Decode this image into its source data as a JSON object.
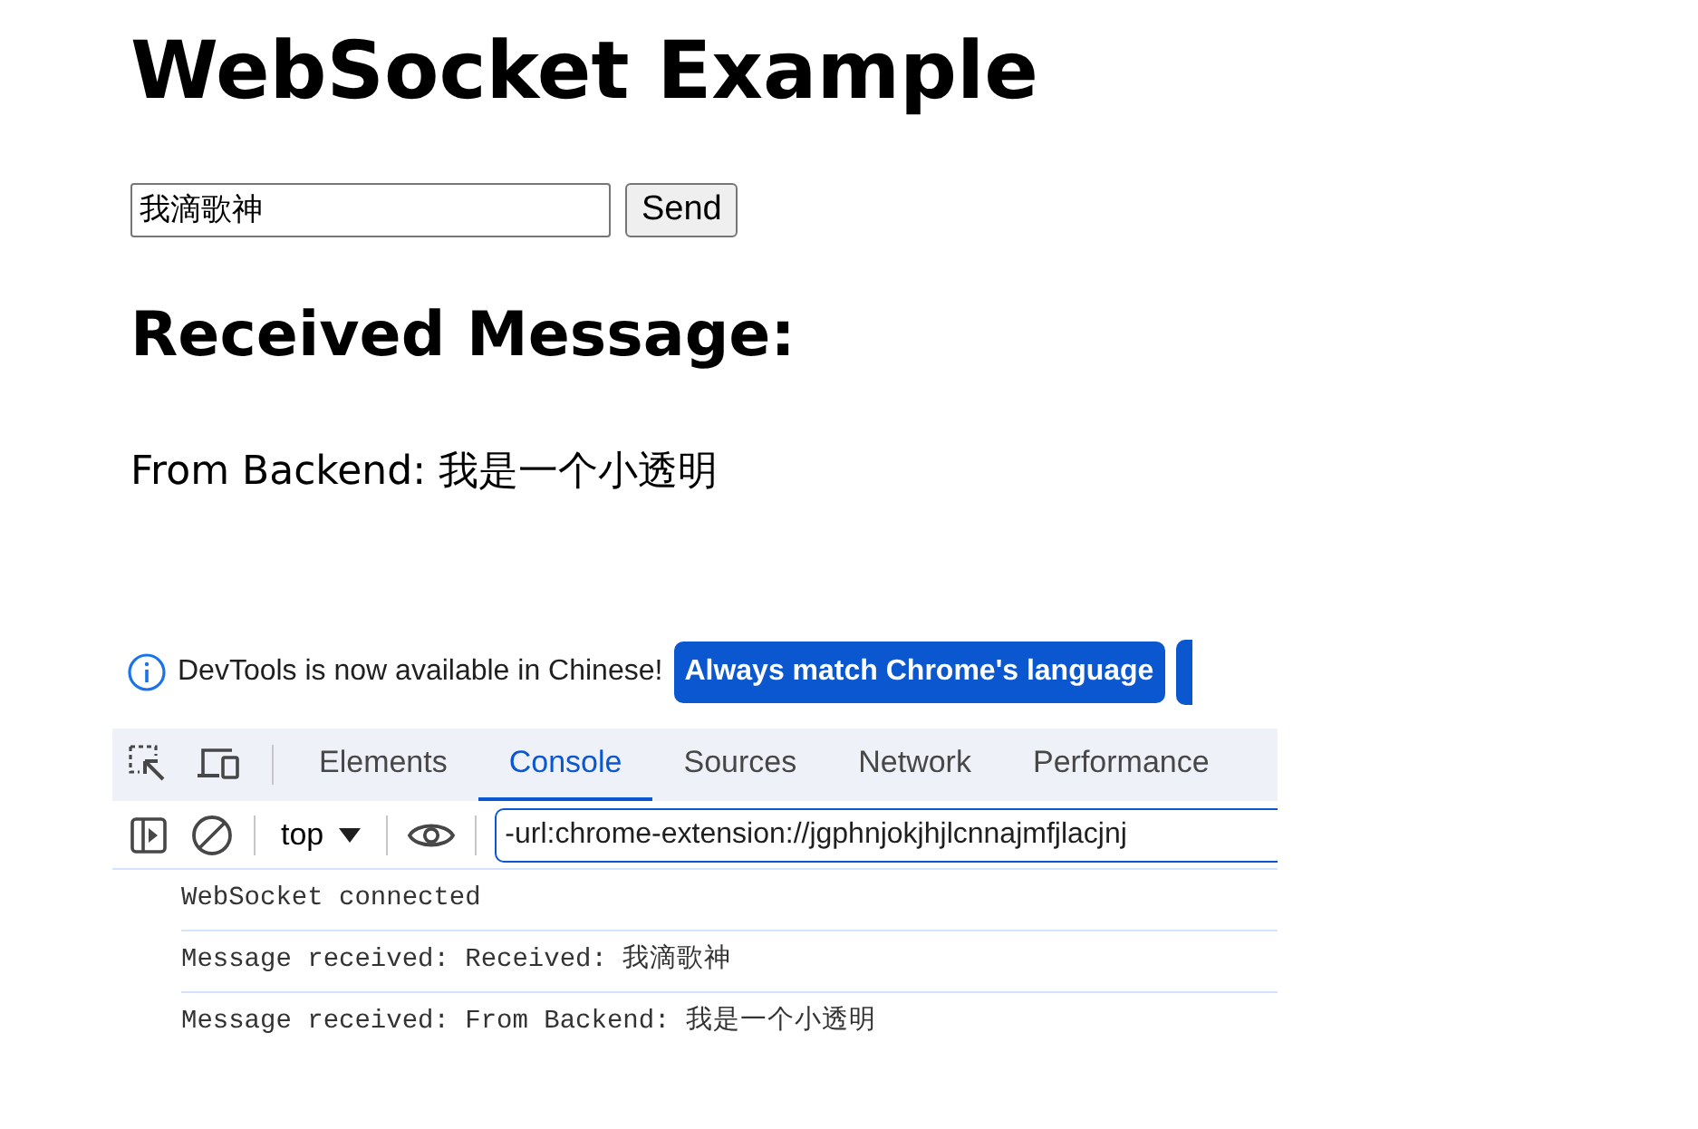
{
  "page": {
    "title": "WebSocket Example",
    "message_input": {
      "value": "我滴歌神"
    },
    "send_button": "Send",
    "received_heading": "Received Message:",
    "received_text": "From Backend: 我是一个小透明"
  },
  "devtools": {
    "infobar": {
      "text": "DevTools is now available in Chinese!",
      "button": "Always match Chrome's language"
    },
    "tabs": [
      {
        "label": "Elements",
        "selected": false
      },
      {
        "label": "Console",
        "selected": true
      },
      {
        "label": "Sources",
        "selected": false
      },
      {
        "label": "Network",
        "selected": false
      },
      {
        "label": "Performance",
        "selected": false
      }
    ],
    "context": "top",
    "filter": {
      "value": "-url:chrome-extension://jgphnjokjhjlcnnajmfjlacjnj"
    },
    "messages": [
      "WebSocket connected",
      "Message received: Received: 我滴歌神",
      "Message received: From Backend: 我是一个小透明"
    ]
  }
}
